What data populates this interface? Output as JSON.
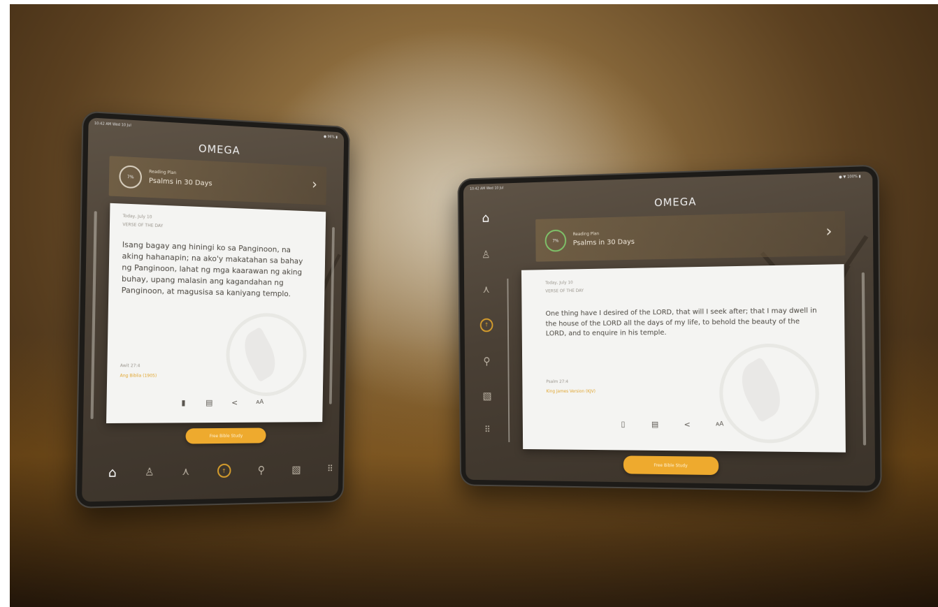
{
  "app": {
    "title": "OMEGA"
  },
  "colors": {
    "accent": "#eeaa2e",
    "card": "#f4f4f2",
    "backdrop": "#5b4020"
  },
  "left_tablet": {
    "status_left": "10:42 AM  Wed 10 Jul",
    "status_right": "● 96% ▮",
    "plan": {
      "caption": "Reading Plan",
      "name": "Psalms in 30 Days",
      "progress": "7%"
    },
    "card": {
      "date": "Today, July 10",
      "label": "VERSE OF THE DAY",
      "verse": "Isang bagay ang hiningi ko sa Panginoon, na aking hahanapin; na ako'y makatahan sa bahay ng Panginoon, lahat ng mga kaarawan ng aking buhay, upang malasin ang kagandahan ng Panginoon, at magusisa sa kaniyang templo.",
      "reference": "Awit 27:4",
      "translation": "Ang Biblia (1905)",
      "actions": [
        "bookmark-icon",
        "notes-icon",
        "share-icon",
        "font-size-icon"
      ]
    },
    "cta": "Free Bible Study",
    "tabs": [
      "home-icon",
      "person-icon",
      "pray-icon",
      "logo-icon",
      "search-icon",
      "notes-icon",
      "grid-icon"
    ]
  },
  "right_tablet": {
    "status_left": "10:42 AM  Wed 10 Jul",
    "status_right": "● ▼ 100% ▮",
    "plan": {
      "caption": "Reading Plan",
      "name": "Psalms in 30 Days",
      "progress": "7%"
    },
    "card": {
      "date": "Today, July 10",
      "label": "VERSE OF THE DAY",
      "verse": "One thing have I desired of the LORD, that will I seek after; that I may dwell in the house of the LORD all the days of my life, to behold the beauty of the LORD, and to enquire in his temple.",
      "reference": "Psalm 27:4",
      "translation": "King James Version (KJV)",
      "actions": [
        "bookmark-icon",
        "notes-icon",
        "share-icon",
        "font-size-icon"
      ]
    },
    "cta": "Free Bible Study",
    "rail": [
      "home-icon",
      "person-icon",
      "pray-icon",
      "logo-icon",
      "search-icon",
      "notes-icon",
      "grid-icon"
    ]
  }
}
